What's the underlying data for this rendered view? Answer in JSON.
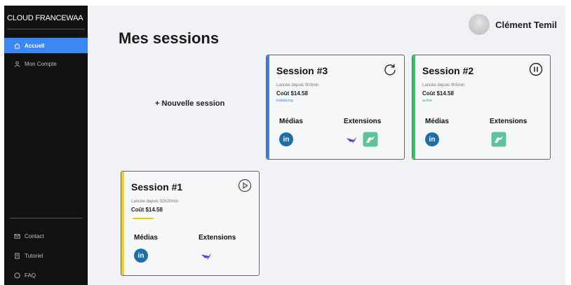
{
  "sidebar": {
    "brand": "CLOUD FRANCEWAA",
    "nav": [
      {
        "label": "Accueil",
        "active": true
      },
      {
        "label": "Mon Compte",
        "active": false
      }
    ],
    "footer": [
      {
        "label": "Contact"
      },
      {
        "label": "Tutoriel"
      },
      {
        "label": "FAQ"
      }
    ]
  },
  "header": {
    "title": "Mes sessions",
    "user_name": "Clément Temil"
  },
  "new_session_label": "+ Nouvelle session",
  "sessions": [
    {
      "title": "Session #3",
      "since": "Lancée depuis 0h3min",
      "cost": "Coût  $14.58",
      "status": "initializing",
      "status_color": "#3b88f5",
      "accent": "#3b82d6",
      "action_icon": "refresh-icon",
      "medias_label": "Médias",
      "extensions_label": "Extensions"
    },
    {
      "title": "Session #2",
      "since": "Lancée depuis 0h5min",
      "cost": "Coût  $14.58",
      "status": "active",
      "status_color": "#2fbf5a",
      "accent": "#36c26a",
      "action_icon": "pause-icon",
      "medias_label": "Médias",
      "extensions_label": "Extensions"
    },
    {
      "title": "Session #1",
      "since": "Lancée depuis 52h20min",
      "cost": "Coût  $14.58",
      "status": "",
      "status_color": "#f0d200",
      "accent": "#f2d21b",
      "action_icon": "play-icon",
      "medias_label": "Médias",
      "extensions_label": "Extensions"
    }
  ],
  "linkedin_label": "in"
}
